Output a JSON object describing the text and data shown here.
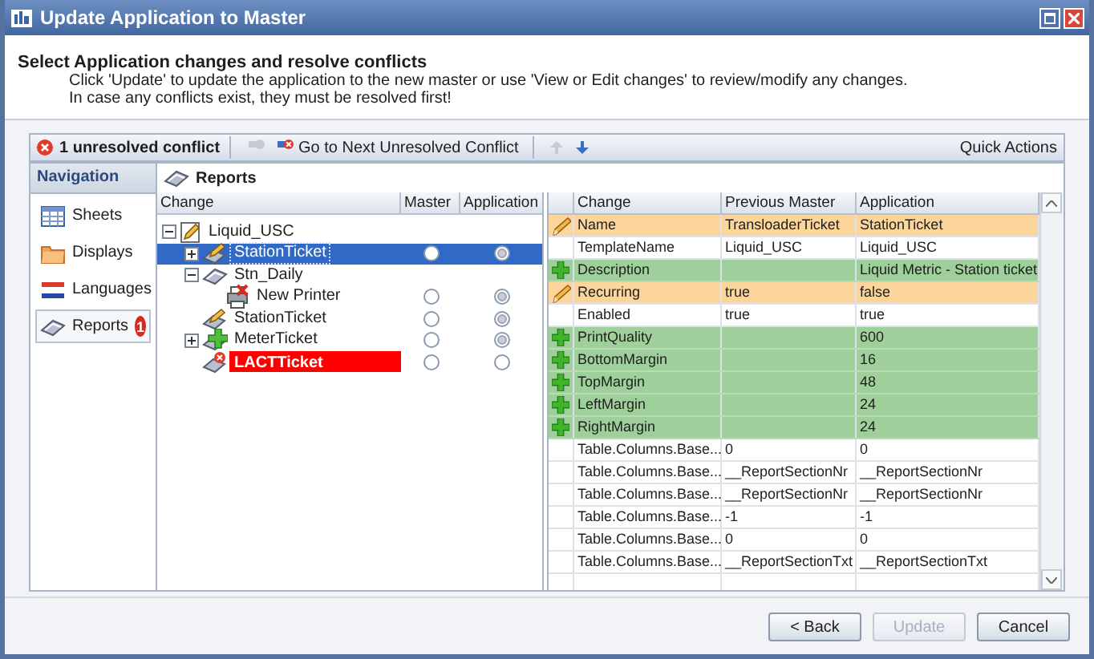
{
  "window": {
    "title": "Update Application to Master"
  },
  "header": {
    "heading": "Select Application changes and resolve conflicts",
    "lines": [
      "Click 'Update' to update the application to the new master or use 'View or Edit changes' to review/modify any changes.",
      "In case any conflicts exist, they must be resolved first!"
    ]
  },
  "toolbar": {
    "conflicts": "1 unresolved conflict",
    "buttons": [
      {
        "kind": "resolve",
        "disabled": true
      },
      {
        "kind": "next",
        "label": "Go to Next Unresolved Conflict",
        "disabled": false
      },
      {
        "kind": "up",
        "disabled": true
      },
      {
        "kind": "down",
        "disabled": false
      }
    ],
    "quick_actions": "Quick Actions"
  },
  "navigation": {
    "title": "Navigation",
    "items": [
      {
        "kind": "sheets",
        "label": "Sheets",
        "selected": false
      },
      {
        "kind": "displays",
        "label": "Displays",
        "selected": false
      },
      {
        "kind": "languages",
        "label": "Languages",
        "selected": false
      },
      {
        "kind": "reports",
        "label": "Reports",
        "selected": true,
        "badge": "1"
      }
    ]
  },
  "tree": {
    "title": "Reports",
    "columns": [
      "Change",
      "Master",
      "Application"
    ],
    "nodes": [
      {
        "label": "Liquid_USC",
        "kind": "template",
        "expanded": true,
        "selected": false,
        "children": [
          {
            "label": "StationTicket",
            "kind": "edit",
            "expanded": false,
            "selected": true,
            "master": false,
            "application": true
          },
          {
            "label": "Stn_Daily",
            "kind": "report",
            "expanded": true,
            "selected": false,
            "children": [
              {
                "label": "New Printer",
                "kind": "removed",
                "selected": false,
                "master": false,
                "application": true
              }
            ]
          },
          {
            "label": "StationTicket",
            "kind": "edit",
            "selected": false,
            "master": false,
            "application": true
          },
          {
            "label": "MeterTicket",
            "kind": "added",
            "expanded": false,
            "selected": false,
            "master": false,
            "application": true
          },
          {
            "label": "LACTTicket",
            "kind": "conflict",
            "selected": false,
            "master": false,
            "application": false
          }
        ]
      }
    ]
  },
  "grid": {
    "columns": [
      "Change",
      "Previous Master",
      "Application"
    ],
    "rows": [
      {
        "kind": "modified",
        "change": "Name",
        "previous_master": "TransloaderTicket",
        "application": "StationTicket"
      },
      {
        "kind": "unchanged",
        "change": "TemplateName",
        "previous_master": "Liquid_USC",
        "application": "Liquid_USC"
      },
      {
        "kind": "added",
        "change": "Description",
        "application": "Liquid Metric - Station ticket"
      },
      {
        "kind": "modified",
        "change": "Recurring",
        "previous_master": "true",
        "application": "false"
      },
      {
        "kind": "unchanged",
        "change": "Enabled",
        "previous_master": "true",
        "application": "true"
      },
      {
        "kind": "added",
        "change": "PrintQuality",
        "application": "600"
      },
      {
        "kind": "added",
        "change": "BottomMargin",
        "application": "16"
      },
      {
        "kind": "added",
        "change": "TopMargin",
        "application": "48"
      },
      {
        "kind": "added",
        "change": "LeftMargin",
        "application": "24"
      },
      {
        "kind": "added",
        "change": "RightMargin",
        "application": "24"
      },
      {
        "kind": "unchanged",
        "change": "Table.Columns.Base...",
        "previous_master": "0",
        "application": "0"
      },
      {
        "kind": "unchanged",
        "change": "Table.Columns.Base...",
        "previous_master": "__ReportSectionNr",
        "application": "__ReportSectionNr"
      },
      {
        "kind": "unchanged",
        "change": "Table.Columns.Base...",
        "previous_master": "__ReportSectionNr",
        "application": "__ReportSectionNr"
      },
      {
        "kind": "unchanged",
        "change": "Table.Columns.Base...",
        "previous_master": "-1",
        "application": "-1"
      },
      {
        "kind": "unchanged",
        "change": "Table.Columns.Base...",
        "previous_master": "0",
        "application": "0"
      },
      {
        "kind": "unchanged",
        "change": "Table.Columns.Base...",
        "previous_master": "__ReportSectionTxt",
        "application": "__ReportSectionTxt"
      }
    ]
  },
  "footer": {
    "buttons": [
      {
        "label": "< Back",
        "disabled": false
      },
      {
        "label": "Update",
        "disabled": true
      },
      {
        "label": "Cancel",
        "disabled": false
      }
    ]
  }
}
